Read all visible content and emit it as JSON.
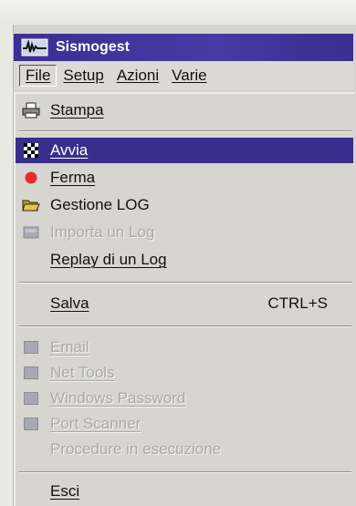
{
  "window": {
    "title": "Sismogest"
  },
  "menubar": {
    "items": [
      {
        "label": "File"
      },
      {
        "label": "Setup"
      },
      {
        "label": "Azioni"
      },
      {
        "label": "Varie"
      }
    ]
  },
  "file_menu": {
    "items": [
      {
        "label": "Stampa",
        "icon": "printer-icon",
        "enabled": true
      },
      {
        "label": "Avvia",
        "icon": "checkered-flag-icon",
        "enabled": true,
        "selected": true
      },
      {
        "label": "Ferma",
        "icon": "red-dot-icon",
        "enabled": true
      },
      {
        "label": "Gestione LOG",
        "icon": "folder-icon",
        "enabled": true
      },
      {
        "label": "Importa un Log",
        "icon": "import-icon",
        "enabled": false
      },
      {
        "label": "Replay di un Log",
        "icon": null,
        "enabled": true
      },
      {
        "label": "Salva",
        "shortcut": "CTRL+S",
        "icon": null,
        "enabled": true
      },
      {
        "label": "Email",
        "icon": "email-icon",
        "enabled": false
      },
      {
        "label": "Net Tools",
        "icon": "net-tools-icon",
        "enabled": false
      },
      {
        "label": "Windows Password",
        "icon": "password-icon",
        "enabled": false
      },
      {
        "label": "Port Scanner",
        "icon": "port-scanner-icon",
        "enabled": false
      },
      {
        "label": "Procedure in esecuzione",
        "icon": null,
        "enabled": false
      },
      {
        "label": "Esci",
        "icon": null,
        "enabled": true
      }
    ]
  },
  "colors": {
    "titlebar": "#3b2f93",
    "selection": "#3a2e8c",
    "menu_bg": "#d7d5d0",
    "disabled_text": "#a9a8a4",
    "ferma_dot": "#e52b2b"
  }
}
